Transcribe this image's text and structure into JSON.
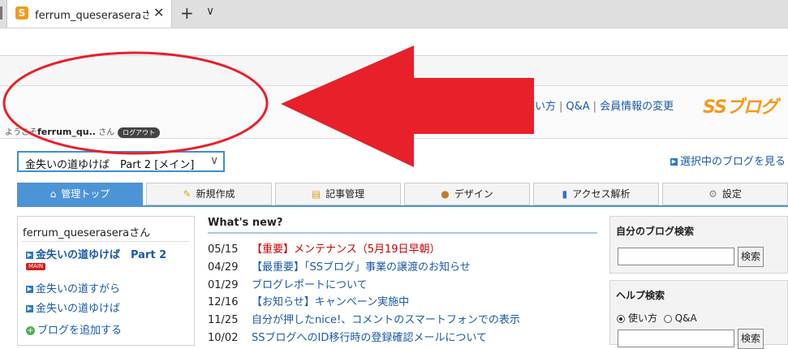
{
  "browser": {
    "tab_title": "ferrum_queseraseraさん(",
    "tab_favicon_letter": "S",
    "close_glyph": "✕",
    "new_tab_glyph": "+",
    "tab_list_glyph": "∨"
  },
  "header": {
    "links": [
      "使い方",
      "Q&A",
      "会員情報の変更"
    ],
    "logo": "SSブログ",
    "welcome_prefix": "ようこそ",
    "username": "ferrum_qu..",
    "welcome_suffix": "さん",
    "logout_label": "ログアウト"
  },
  "blog_selector": {
    "selected": "金失いの道ゆけば　Part 2 [メイン]",
    "view_link": "選択中のブログを見る"
  },
  "nav_tabs": [
    {
      "label": "管理トップ",
      "icon": "home-icon"
    },
    {
      "label": "新規作成",
      "icon": "compose-icon"
    },
    {
      "label": "記事管理",
      "icon": "folder-icon"
    },
    {
      "label": "デザイン",
      "icon": "palette-icon"
    },
    {
      "label": "アクセス解析",
      "icon": "bar-chart-icon"
    },
    {
      "label": "設定",
      "icon": "gear-icon"
    }
  ],
  "left_panel": {
    "user": "ferrum_queseraseraさん",
    "main_badge": "MAIN",
    "blogs": [
      "金失いの道ゆけば　Part 2",
      "金失いの道すがら",
      "金失いの道ゆけば"
    ],
    "add_blog": "ブログを追加する"
  },
  "news": {
    "title": "What's new?",
    "items": [
      {
        "date": "05/15",
        "text": "【重要】メンテナンス（5月19日早朝）",
        "important": true
      },
      {
        "date": "04/29",
        "text": "【最重要】「SSブログ」事業の譲渡のお知らせ",
        "important": false
      },
      {
        "date": "01/29",
        "text": "ブログレポートについて",
        "important": false
      },
      {
        "date": "12/16",
        "text": "【お知らせ】キャンペーン実施中",
        "important": false
      },
      {
        "date": "11/25",
        "text": "自分が押したnice!、コメントのスマートフォンでの表示",
        "important": false
      },
      {
        "date": "10/02",
        "text": "SSブログへのID移行時の登録確認メールについて",
        "important": false
      }
    ]
  },
  "blog_search": {
    "title": "自分のブログ検索",
    "button": "検索"
  },
  "help_search": {
    "title": "ヘルプ検索",
    "options": [
      "使い方",
      "Q&A"
    ],
    "selected": "使い方",
    "button": "検索"
  },
  "annotation": {
    "color": "#e8202a"
  }
}
